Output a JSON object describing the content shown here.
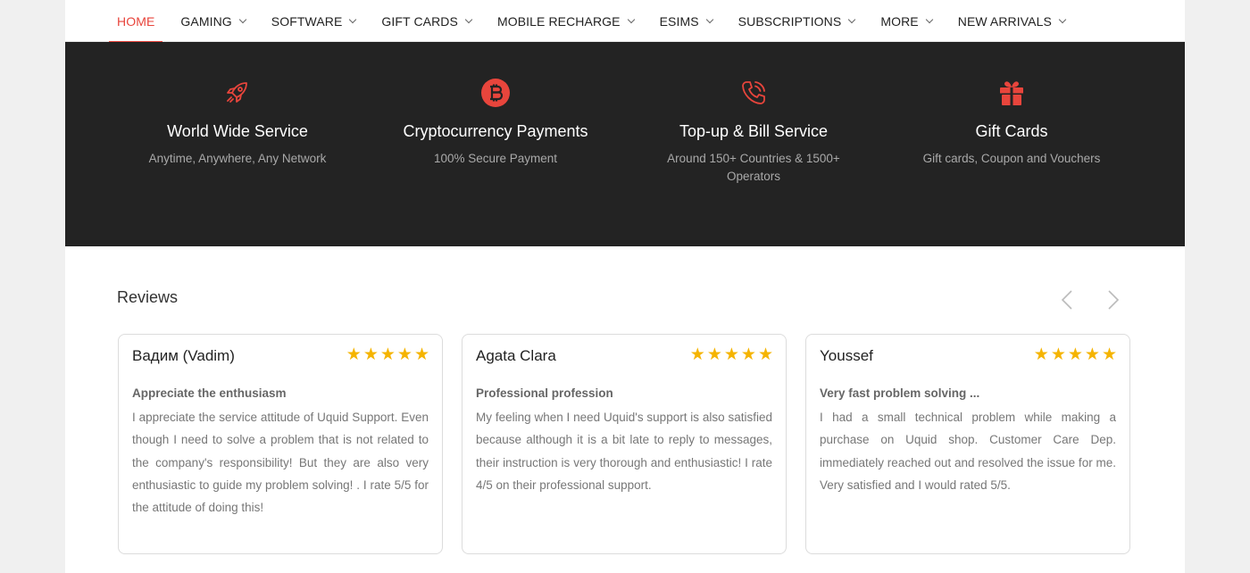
{
  "nav": {
    "items": [
      {
        "label": "HOME",
        "active": true,
        "dropdown": false
      },
      {
        "label": "GAMING",
        "active": false,
        "dropdown": true
      },
      {
        "label": "SOFTWARE",
        "active": false,
        "dropdown": true
      },
      {
        "label": "GIFT CARDS",
        "active": false,
        "dropdown": true
      },
      {
        "label": "MOBILE RECHARGE",
        "active": false,
        "dropdown": true
      },
      {
        "label": "ESIMS",
        "active": false,
        "dropdown": true
      },
      {
        "label": "SUBSCRIPTIONS",
        "active": false,
        "dropdown": true
      },
      {
        "label": "MORE",
        "active": false,
        "dropdown": true
      },
      {
        "label": "NEW ARRIVALS",
        "active": false,
        "dropdown": true
      }
    ]
  },
  "features": [
    {
      "icon": "rocket-icon",
      "title": "World Wide Service",
      "subtitle": "Anytime, Anywhere, Any Network"
    },
    {
      "icon": "bitcoin-icon",
      "title": "Cryptocurrency Payments",
      "subtitle": "100% Secure Payment"
    },
    {
      "icon": "phone-icon",
      "title": "Top-up & Bill Service",
      "subtitle": "Around 150+ Countries & 1500+ Operators"
    },
    {
      "icon": "gift-icon",
      "title": "Gift Cards",
      "subtitle": "Gift cards, Coupon and Vouchers"
    }
  ],
  "reviews": {
    "title": "Reviews",
    "items": [
      {
        "name": "Вадим (Vadim)",
        "rating": 5,
        "title": "Appreciate the enthusiasm",
        "text": "I appreciate the service attitude of Uquid Support. Even though I need to solve a problem that is not related to the company's responsibility! But they are also very enthusiastic to guide my problem solving! . I rate 5/5 for the attitude of doing this!"
      },
      {
        "name": "Agata Clara",
        "rating": 5,
        "title": "Professional profession",
        "text": "My feeling when I need Uquid's support is also satisfied because although it is a bit late to reply to messages, their instruction is very thorough and enthusiastic! I rate 4/5 on their professional support."
      },
      {
        "name": "Youssef",
        "rating": 5,
        "title": "Very fast problem solving ...",
        "text": "I had a small technical problem while making a purchase on Uquid shop. Customer Care Dep. immediately reached out and resolved the issue for me. Very satisfied and I would rated 5/5."
      }
    ]
  },
  "colors": {
    "accent": "#e8453c",
    "star": "#f5b400",
    "dark_band": "#232323"
  }
}
